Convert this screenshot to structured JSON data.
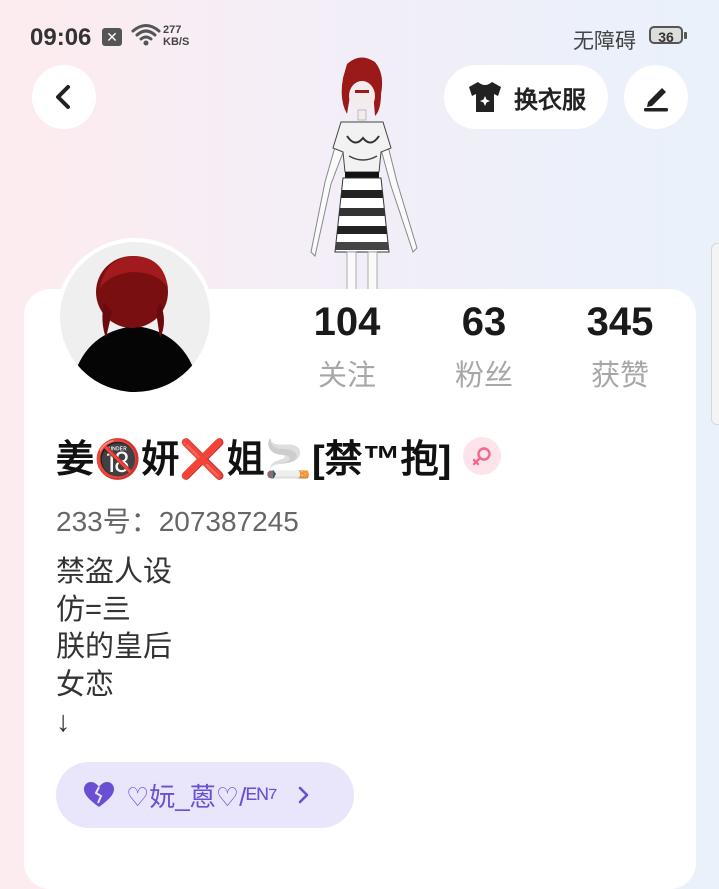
{
  "status_bar": {
    "time": "09:06",
    "notification_icon": "x-box-icon",
    "wifi_icon": "wifi-icon",
    "net_speed_value": "277",
    "net_speed_unit": "KB/S",
    "accessibility": "无障碍",
    "battery": "36"
  },
  "header": {
    "back_icon": "chevron-left-icon",
    "outfit_label": "换衣服",
    "outfit_icon": "shirt-icon",
    "edit_icon": "pen-icon"
  },
  "stats": [
    {
      "value": "104",
      "label": "关注"
    },
    {
      "value": "63",
      "label": "粉丝"
    },
    {
      "value": "345",
      "label": "获赞"
    }
  ],
  "profile": {
    "name": "姜🔞妍❌姐🚬[禁™抱]",
    "gender_icon": "female-icon",
    "uid": "233号：207387245",
    "bio_lines": [
      "禁盗人设",
      "仿=亖",
      "朕的皇后",
      "女恋",
      "↓"
    ]
  },
  "tag": {
    "label": "♡妧_蒽♡/ᴱᴺ⁷",
    "icon": "heart-icon"
  },
  "colors": {
    "accent_purple": "#6a4fd4",
    "tag_bg": "#e9e5fb",
    "gender_pink": "#f06a8f"
  }
}
